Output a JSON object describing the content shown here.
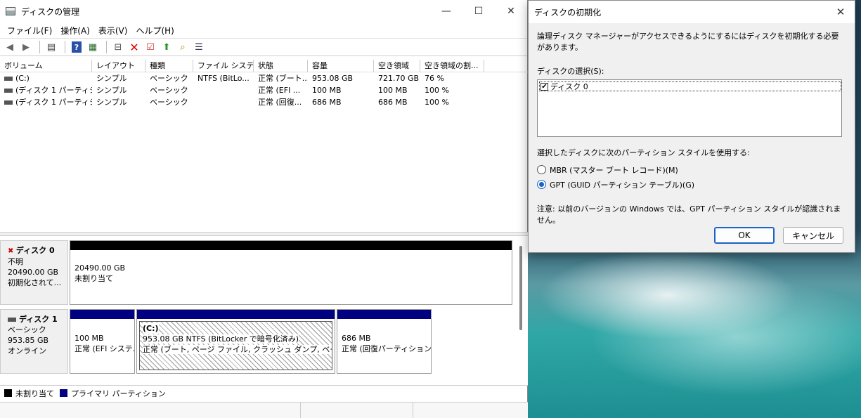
{
  "main_window": {
    "title": "ディスクの管理",
    "controls": {
      "minimize": "—",
      "maximize": "☐",
      "close": "✕"
    },
    "menu": [
      "ファイル(F)",
      "操作(A)",
      "表示(V)",
      "ヘルプ(H)"
    ],
    "toolbar_icons": [
      "back-arrow-icon",
      "forward-arrow-icon",
      "console-tree-icon",
      "help-icon",
      "help-topics-icon",
      "connect-drive-icon",
      "delete-icon",
      "properties-icon",
      "up-arrow-icon",
      "search-icon",
      "list-icon"
    ],
    "columns": [
      "ボリューム",
      "レイアウト",
      "種類",
      "ファイル システム",
      "状態",
      "容量",
      "空き領域",
      "空き領域の割..."
    ],
    "volumes": [
      [
        "(C:)",
        "シンプル",
        "ベーシック",
        "NTFS (BitLo...",
        "正常 (ブート...",
        "953.08 GB",
        "721.70 GB",
        "76 %"
      ],
      [
        "(ディスク 1 パーティシ...",
        "シンプル",
        "ベーシック",
        "",
        "正常 (EFI ...",
        "100 MB",
        "100 MB",
        "100 %"
      ],
      [
        "(ディスク 1 パーティシ...",
        "シンプル",
        "ベーシック",
        "",
        "正常 (回復...",
        "686 MB",
        "686 MB",
        "100 %"
      ]
    ],
    "disks": {
      "disk0": {
        "name": "ディスク 0",
        "type": "不明",
        "size": "20490.00 GB",
        "status": "初期化されて...",
        "partition": {
          "size": "20490.00 GB",
          "label": "未割り当て"
        }
      },
      "disk1": {
        "name": "ディスク 1",
        "type": "ベーシック",
        "size": "953.85 GB",
        "status": "オンライン",
        "partitions": [
          {
            "line1": "",
            "line2": "100 MB",
            "line3": "正常 (EFI システ..."
          },
          {
            "line1": "(C:)",
            "line2": "953.08 GB NTFS (BitLocker で暗号化済み)",
            "line3": "正常 (ブート, ページ ファイル, クラッシュ ダンプ, ベーシック デ..."
          },
          {
            "line1": "",
            "line2": "686 MB",
            "line3": "正常 (回復パーティション)"
          }
        ]
      }
    },
    "legend": {
      "unallocated": "未割り当て",
      "primary": "プライマリ パーティション"
    },
    "colors": {
      "unallocated": "#000000",
      "primary": "#000080"
    }
  },
  "dialog": {
    "title": "ディスクの初期化",
    "close": "✕",
    "description": "論理ディスク マネージャーがアクセスできるようにするにはディスクを初期化する必要があります。",
    "select_label": "ディスクの選択(S):",
    "disk_item": "ディスク 0",
    "partition_style_label": "選択したディスクに次のパーティション スタイルを使用する:",
    "mbr_label": "MBR (マスター ブート レコード)(M)",
    "gpt_label": "GPT (GUID パーティション テーブル)(G)",
    "note": "注意: 以前のバージョンの Windows では、GPT パーティション スタイルが認識されません。",
    "ok_label": "OK",
    "cancel_label": "キャンセル",
    "accent": "#1a63c9"
  }
}
